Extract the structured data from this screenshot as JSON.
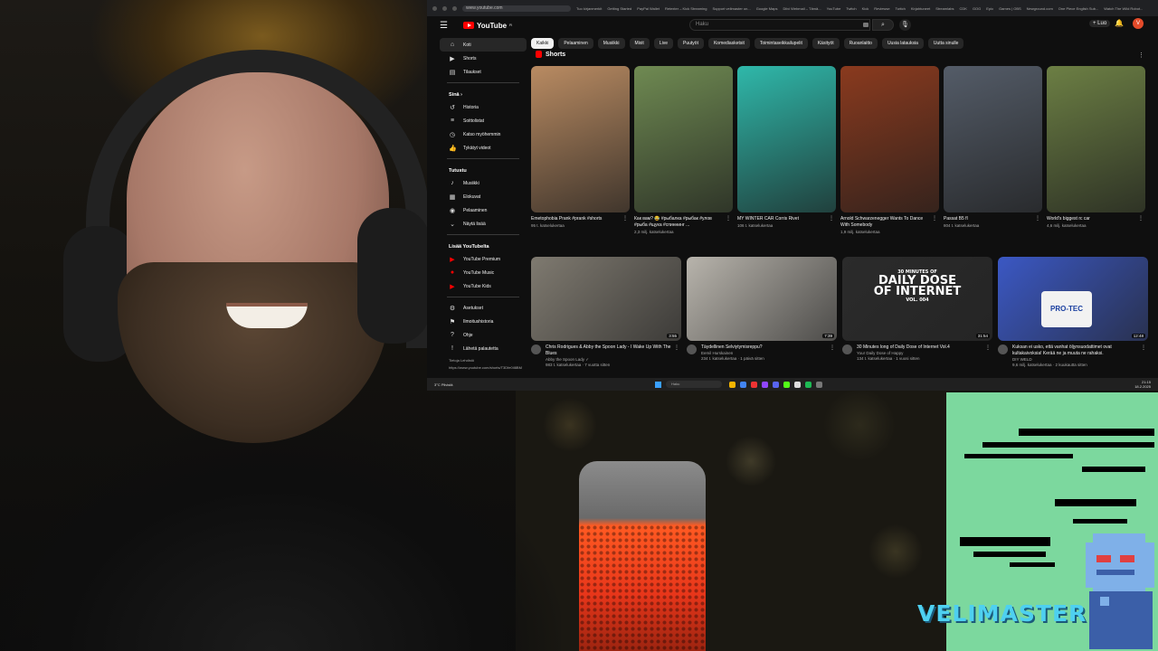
{
  "browser": {
    "url": "www.youtube.com",
    "bookmarks": [
      "Tuo kirjanmerkit",
      "Getting Started",
      "PayPal Wallet",
      "Retexter – Kick Streaming",
      "Support velimaster on...",
      "Google Maps",
      "Diivi Webmail – Tämä...",
      "YouTube",
      "Twitch",
      "Kick",
      "Reviewse",
      "Twitch",
      "Kirjahtuneet",
      "Streamlabs",
      "CDK",
      "GOG",
      "Epic",
      "Games | OBS",
      "Newground.com",
      "One Piece English Sub...",
      "Watch The Wild Robot..."
    ]
  },
  "header": {
    "logo_text": "YouTube",
    "logo_country": "FI",
    "search_placeholder": "Haku",
    "create_label": "+ Luo",
    "avatar_letter": "V"
  },
  "sidebar": {
    "main": [
      {
        "label": "Koti",
        "icon": "home-icon",
        "active": true
      },
      {
        "label": "Shorts",
        "icon": "shorts-icon"
      },
      {
        "label": "Tilaukset",
        "icon": "subscriptions-icon"
      }
    ],
    "you_heading": "Sinä",
    "you": [
      {
        "label": "Historia",
        "icon": "history-icon"
      },
      {
        "label": "Soittolistat",
        "icon": "playlist-icon"
      },
      {
        "label": "Katso myöhemmin",
        "icon": "clock-icon"
      },
      {
        "label": "Tykätyt videot",
        "icon": "thumbs-up-icon"
      }
    ],
    "explore_heading": "Tutustu",
    "explore": [
      {
        "label": "Musiikki",
        "icon": "music-icon"
      },
      {
        "label": "Elokuvat",
        "icon": "film-icon"
      },
      {
        "label": "Pelaaminen",
        "icon": "gamepad-icon"
      },
      {
        "label": "Näytä lisää",
        "icon": "chevron-down-icon"
      }
    ],
    "more_heading": "Lisää YouTubelta",
    "more": [
      {
        "label": "YouTube Premium",
        "icon": "youtube-premium-icon"
      },
      {
        "label": "YouTube Music",
        "icon": "youtube-music-icon"
      },
      {
        "label": "YouTube Kids",
        "icon": "youtube-kids-icon"
      }
    ],
    "settings": [
      {
        "label": "Asetukset",
        "icon": "gear-icon"
      },
      {
        "label": "Ilmoitushistoria",
        "icon": "flag-icon"
      },
      {
        "label": "Ohje",
        "icon": "help-icon"
      },
      {
        "label": "Lähetä palautetta",
        "icon": "feedback-icon"
      }
    ],
    "footer_links": "Tietoja  Lehdistö",
    "status_url": "https://www.youtube.com/shorts/T3Dfe0iI8BM"
  },
  "chips": [
    "Kaikki",
    "Pelaaminen",
    "Musiikki",
    "Mixit",
    "Live",
    "Puutyöt",
    "Komediasketsit",
    "Toimintaseikkailupelit",
    "Käsityöt",
    "Ruoanlaitto",
    "Uusia latauksia",
    "Uutta sinulle"
  ],
  "shorts_heading": "Shorts",
  "shorts": [
    {
      "title": "Emetophobia Prank #prank #shorts",
      "views": "95 t. katselukertaa",
      "thumb": "#b98b62"
    },
    {
      "title": "Как вам? 😂 #рыбалка #рыбак #улов #рыба #щука #спиннинг ...",
      "views": "2,3 milj. katselukertaa",
      "thumb": "#6f8a52"
    },
    {
      "title": "MY WINTER CAR Corris Rivet",
      "views": "106 t. katselukertaa",
      "thumb": "#2fb8aa"
    },
    {
      "title": "Arnold Schwarzenegger Wants To Dance With Somebody",
      "views": "1,9 milj. katselukertaa",
      "thumb": "#8a3a1e"
    },
    {
      "title": "Passat B5 fl",
      "views": "804 t. katselukertaa",
      "thumb": "#545c68"
    },
    {
      "title": "World's biggest rc car",
      "views": "4,6 milj. katselukertaa",
      "thumb": "#6c7f44"
    }
  ],
  "videos": [
    {
      "title": "Chris Rodrigues & Abby the Spoon Lady - I Wake Up With The Blues",
      "channel": "Abby the Spoon Lady ✓",
      "stats": "983 t. katselukertaa · 7 vuotta sitten",
      "duration": "3:55",
      "thumb": "#7f7a70"
    },
    {
      "title": "Täydellinen Selviytymisreppu?",
      "channel": "Eemil Hurskainen",
      "stats": "234 t. katselukertaa · 1 päivä sitten",
      "duration": "7:39",
      "thumb": "#b8b4ac"
    },
    {
      "title": "30 Minutes long of Daily Dose of Internet Vol.4",
      "channel": "Your Daily Dose of Happy",
      "stats": "134 t. katselukertaa · 1 vuosi sitten",
      "duration": "31:54",
      "thumb": "#2b2b2b",
      "overlay_line1": "30 MINUTES OF",
      "overlay_line2": "DAILY DOSE",
      "overlay_line3": "OF INTERNET",
      "overlay_line4": "VOL. 004"
    },
    {
      "title": "Kuksan ei usko, että vanhat öljynsuodattimet ovat kultakaivoksia! Kerää ne ja muuta ne rahaksi.",
      "channel": "DIY WELD",
      "stats": "9,6 milj. katselukertaa · 2 kuukautta sitten",
      "duration": "12:48",
      "thumb": "#3b58c4",
      "label": "PRO-TEC"
    }
  ],
  "taskbar": {
    "weather": "3°C Pilvistä",
    "search": "Haku",
    "time": "21:15",
    "date": "18.2.2025"
  },
  "overlay": {
    "brand": "VELIMASTER"
  },
  "colors": {
    "yt_red": "#ff0000",
    "game_green": "#7cd89e",
    "brand_cyan": "#4ed0f0",
    "mic_orange": "#ff5a22"
  }
}
